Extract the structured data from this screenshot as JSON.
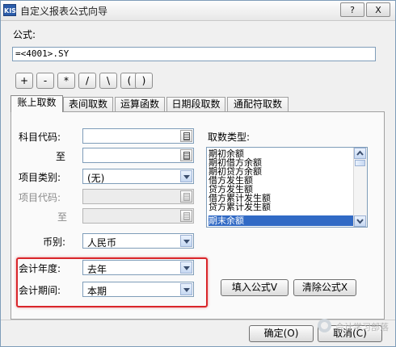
{
  "window": {
    "app_icon_text": "KIS",
    "title": "自定义报表公式向导",
    "help_button": "?",
    "close_button": "X"
  },
  "formula": {
    "label": "公式:",
    "value": "=<4001>.SY"
  },
  "operators": [
    "+",
    "-",
    "*",
    "/",
    "\\",
    "(",
    ")"
  ],
  "tabs": [
    {
      "label": "账上取数",
      "active": true
    },
    {
      "label": "表间取数",
      "active": false
    },
    {
      "label": "运算函数",
      "active": false
    },
    {
      "label": "日期段取数",
      "active": false
    },
    {
      "label": "通配符取数",
      "active": false
    }
  ],
  "form": {
    "account_code_label": "科目代码:",
    "account_code_value": "",
    "to_label_1": "至",
    "account_code_to_value": "",
    "item_category_label": "项目类别:",
    "item_category_value": "(无)",
    "item_code_label": "项目代码:",
    "item_code_value": "",
    "to_label_2": "至",
    "item_code_to_value": "",
    "currency_label": "币别:",
    "currency_value": "人民币",
    "fiscal_year_label": "会计年度:",
    "fiscal_year_value": "去年",
    "fiscal_period_label": "会计期间:",
    "fiscal_period_value": "本期"
  },
  "fetch_type": {
    "label": "取数类型:",
    "options": [
      "期初余额",
      "期初借方余额",
      "期初贷方余额",
      "借方发生额",
      "贷方发生额",
      "借方累计发生额",
      "贷方累计发生额",
      "期末余额"
    ],
    "selected": "期末余额"
  },
  "actions": {
    "insert_formula": "填入公式V",
    "clear_formula": "清除公式X",
    "ok": "确定(O)",
    "cancel": "取消(C)"
  },
  "watermark": "会计学习部落",
  "colors": {
    "highlight_border": "#d9262b",
    "selection": "#316ac5",
    "field_border": "#7f9db9"
  }
}
